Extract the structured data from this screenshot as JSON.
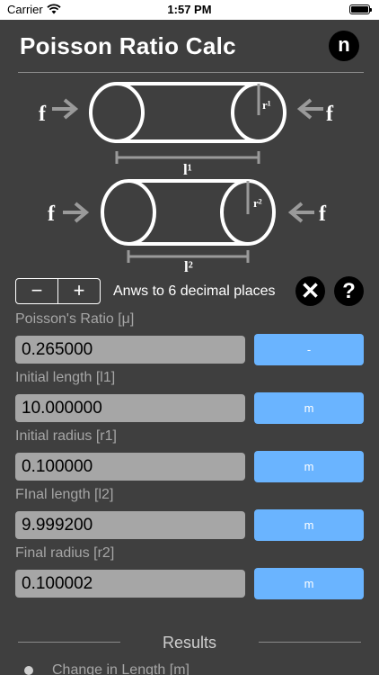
{
  "status_bar": {
    "carrier": "Carrier",
    "time": "1:57 PM",
    "battery_level": 1.0
  },
  "header": {
    "title": "Poisson Ratio Calc",
    "logo_letter": "n"
  },
  "diagram": {
    "force_label": "f",
    "top_radius_label": "r¹",
    "top_length_label": "l¹",
    "bottom_radius_label": "r²",
    "bottom_length_label": "l²"
  },
  "controls": {
    "minus_label": "−",
    "plus_label": "+",
    "decimal_text": "Anws to 6 decimal places",
    "clear_label": "✕",
    "help_label": "?"
  },
  "fields": [
    {
      "label": "Poisson's Ratio [μ]",
      "value": "0.265000",
      "unit": "-"
    },
    {
      "label": "Initial length [l1]",
      "value": "10.000000",
      "unit": "m"
    },
    {
      "label": "Initial radius [r1]",
      "value": "0.100000",
      "unit": "m"
    },
    {
      "label": "FInal length [l2]",
      "value": "9.999200",
      "unit": "m"
    },
    {
      "label": "Final radius [r2]",
      "value": "0.100002",
      "unit": "m"
    }
  ],
  "results": {
    "title": "Results",
    "items": [
      {
        "label": "Change in Length [m]"
      }
    ]
  },
  "colors": {
    "background": "#3f3f3f",
    "accent": "#6ab4ff",
    "field": "#a6a6a6",
    "arrow": "#9a9a9a"
  }
}
